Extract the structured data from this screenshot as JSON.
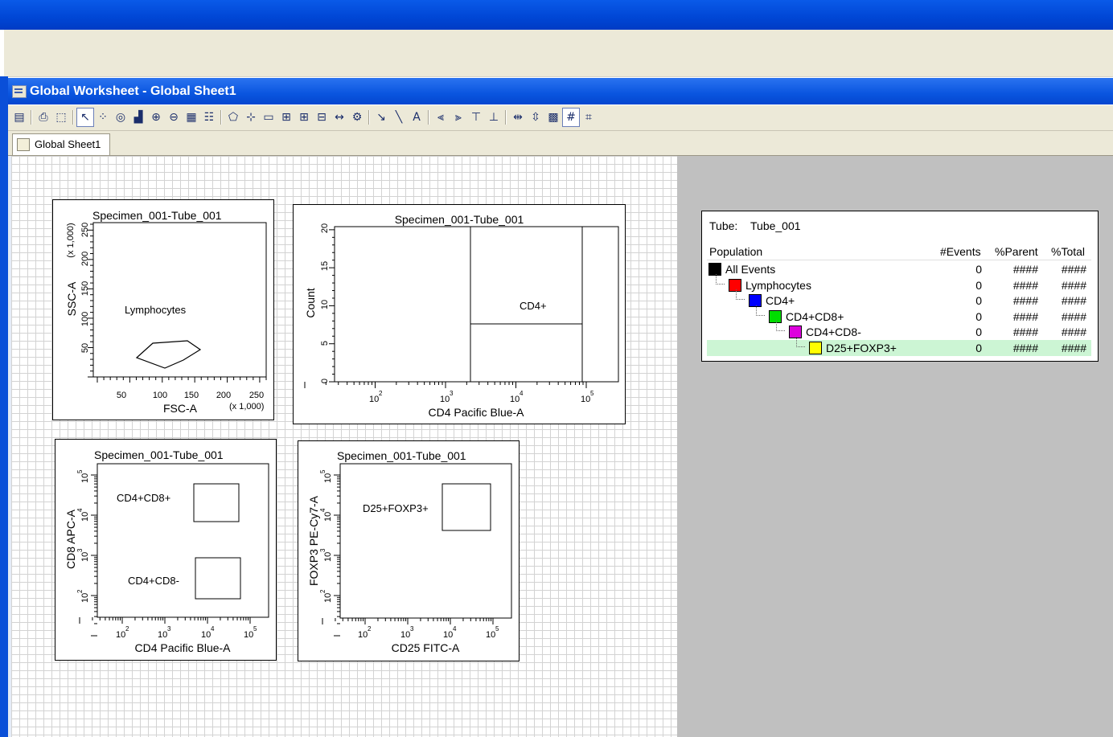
{
  "worksheet": {
    "title": "Global Worksheet - Global Sheet1",
    "tab_label": "Global Sheet1"
  },
  "toolbar": {
    "icons": [
      "save-icon",
      "print-icon",
      "pdf-icon",
      "pointer-icon",
      "dot-plot-icon",
      "contour-plot-icon",
      "histogram-icon",
      "zoom-in-icon",
      "zoom-out-icon",
      "stats-view-icon",
      "population-hierarchy-icon",
      "polygon-gate-icon",
      "snap-to-gate-icon",
      "rectangle-gate-icon",
      "interval-gate-icon",
      "quadrant-gate-icon",
      "hinged-quadrant-icon",
      "interval-marker-icon",
      "auto-gate-icon",
      "arrow-tool-icon",
      "line-tool-icon",
      "text-tool-icon",
      "align-left-icon",
      "align-right-icon",
      "align-top-icon",
      "align-bottom-icon",
      "distribute-horizontal-icon",
      "distribute-vertical-icon",
      "arrange-icon",
      "grid-icon",
      "snap-to-grid-icon"
    ]
  },
  "plots": {
    "fsc_ssc": {
      "title": "Specimen_001-Tube_001",
      "xlabel": "FSC-A",
      "ylabel": "SSC-A",
      "x_multiplier": "(x 1,000)",
      "y_multiplier": "(x 1,000)",
      "x_ticks": [
        "50",
        "100",
        "150",
        "200",
        "250"
      ],
      "y_ticks": [
        "50",
        "100",
        "150",
        "200",
        "250"
      ],
      "gate_label": "Lymphocytes"
    },
    "cd4_hist": {
      "title": "Specimen_001-Tube_001",
      "xlabel": "CD4 Pacific Blue-A",
      "ylabel": "Count",
      "x_ticks": [
        "2",
        "3",
        "4",
        "5"
      ],
      "y_ticks": [
        "0",
        "5",
        "10",
        "15",
        "20"
      ],
      "tick_base": "10",
      "gate_label": "CD4+"
    },
    "cd4_cd8": {
      "title": "Specimen_001-Tube_001",
      "xlabel": "CD4 Pacific Blue-A",
      "ylabel": "CD8 APC-A",
      "x_ticks": [
        "2",
        "3",
        "4",
        "5"
      ],
      "y_ticks": [
        "2",
        "3",
        "4",
        "5"
      ],
      "tick_base": "10",
      "gate_labels": [
        "CD4+CD8+",
        "CD4+CD8-"
      ]
    },
    "cd25_foxp3": {
      "title": "Specimen_001-Tube_001",
      "xlabel": "CD25 FITC-A",
      "ylabel": "FOXP3 PE-Cy7-A",
      "x_ticks": [
        "2",
        "3",
        "4",
        "5"
      ],
      "y_ticks": [
        "2",
        "3",
        "4",
        "5"
      ],
      "tick_base": "10",
      "gate_label": "D25+FOXP3+"
    }
  },
  "stats": {
    "tube_label": "Tube:",
    "tube_name": "Tube_001",
    "headers": {
      "population": "Population",
      "events": "#Events",
      "parent": "%Parent",
      "total": "%Total"
    },
    "rows": [
      {
        "name": "All Events",
        "color": "#000000",
        "events": "0",
        "parent": "####",
        "total": "####"
      },
      {
        "name": "Lymphocytes",
        "color": "#ff0000",
        "events": "0",
        "parent": "####",
        "total": "####"
      },
      {
        "name": "CD4+",
        "color": "#0000ff",
        "events": "0",
        "parent": "####",
        "total": "####"
      },
      {
        "name": "CD4+CD8+",
        "color": "#00dd00",
        "events": "0",
        "parent": "####",
        "total": "####"
      },
      {
        "name": "CD4+CD8-",
        "color": "#dd00dd",
        "events": "0",
        "parent": "####",
        "total": "####"
      },
      {
        "name": "D25+FOXP3+",
        "color": "#ffff00",
        "events": "0",
        "parent": "####",
        "total": "####"
      }
    ]
  }
}
